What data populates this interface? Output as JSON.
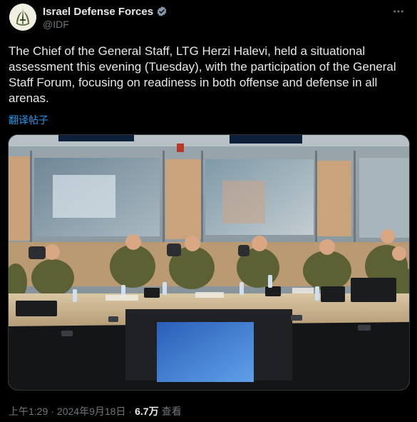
{
  "author": {
    "display_name": "Israel Defense Forces",
    "handle": "@IDF",
    "verified_icon": "verified-badge-icon",
    "avatar_icon": "idf-emblem-icon"
  },
  "more_icon": "more-options-icon",
  "tweet": {
    "text": "The Chief of the General Staff, LTG Herzi Halevi, held a situational assessment this evening (Tuesday), with the participation of the General Staff Forum, focusing on readiness in both offense and defense in all arenas.",
    "translate_label": "翻译帖子"
  },
  "media": {
    "description_icon": "photo-icon"
  },
  "meta": {
    "time": "上午1:29",
    "separator": "·",
    "date": "2024年9月18日",
    "views_count": "6.7万",
    "views_label": "查看"
  },
  "colors": {
    "background": "#000000",
    "text": "#e7e9ea",
    "muted": "#71767b",
    "link": "#1d9bf0",
    "verified": "#829aab"
  }
}
